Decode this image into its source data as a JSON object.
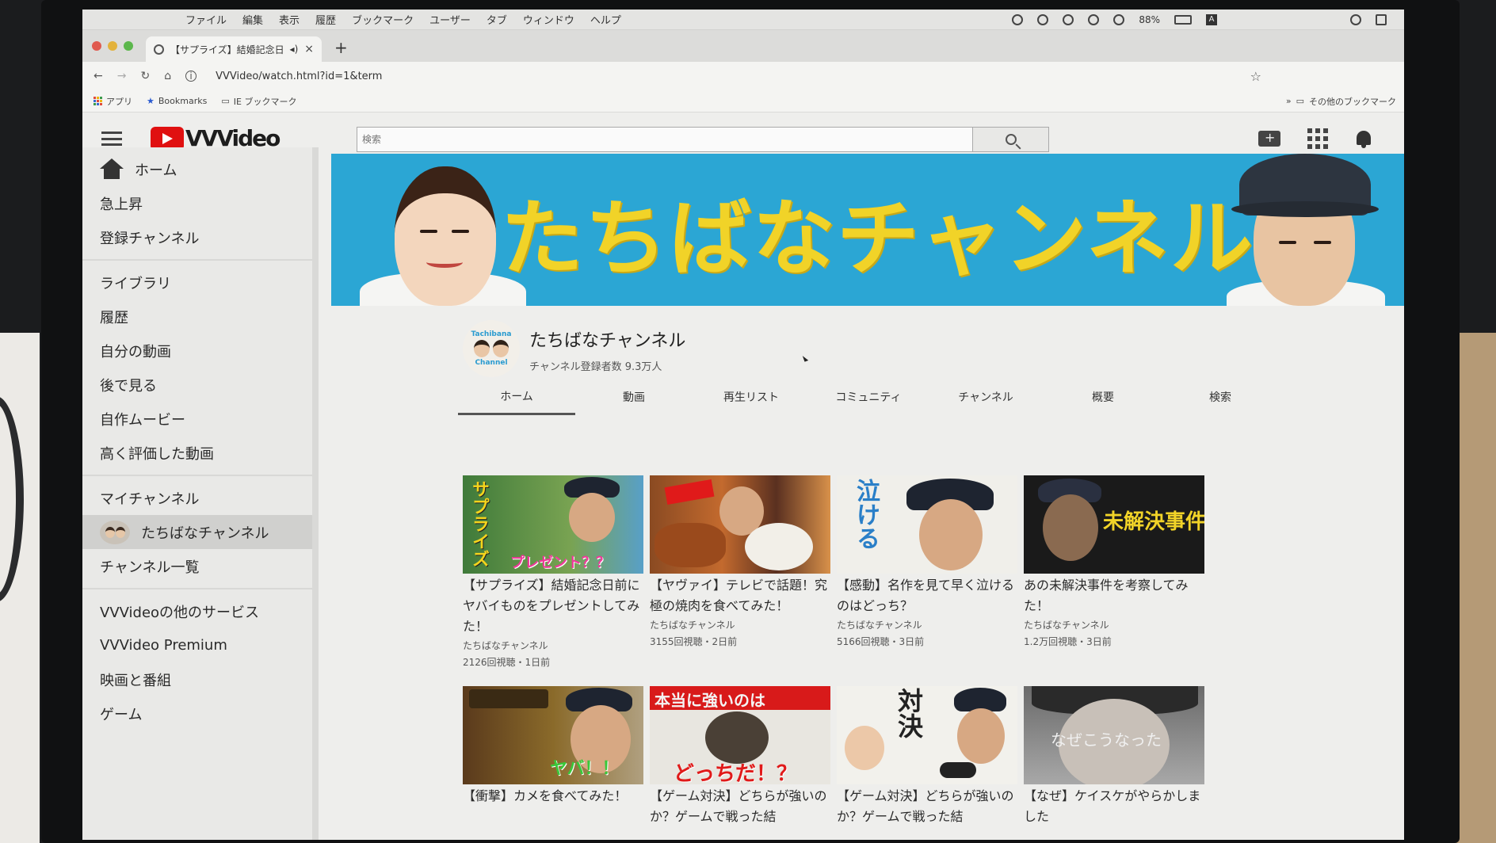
{
  "menubar": {
    "items": [
      "ファイル",
      "編集",
      "表示",
      "履歴",
      "ブックマーク",
      "ユーザー",
      "タブ",
      "ウィンドウ",
      "ヘルプ"
    ],
    "battery": "88%",
    "input_mode": "A"
  },
  "browser": {
    "tab_title": "【サプライズ】結婚記念日",
    "url": "VVVideo/watch.html?id=1&term",
    "bookmarks": {
      "apps": "アプリ",
      "bookmarks": "Bookmarks",
      "ie": "IE ブックマーク",
      "other": "その他のブックマーク"
    }
  },
  "app": {
    "logo": "VVVideo",
    "search_placeholder": "検索"
  },
  "sidebar": {
    "section1": [
      "ホーム",
      "急上昇",
      "登録チャンネル"
    ],
    "section2": [
      "ライブラリ",
      "履歴",
      "自分の動画",
      "後で見る",
      "自作ムービー",
      "高く評価した動画"
    ],
    "section3_title": "マイチャンネル",
    "active_channel": "たちばなチャンネル",
    "channel_list": "チャンネル一覧",
    "section4": [
      "VVVideoの他のサービス",
      "VVVideo Premium",
      "映画と番組",
      "ゲーム"
    ]
  },
  "channel": {
    "banner_title": "たちばなチャンネル",
    "avatar_text_top": "Tachibana",
    "avatar_text_bottom": "Channel",
    "name": "たちばなチャンネル",
    "subscribers": "チャンネル登録者数 9.3万人",
    "tabs": [
      "ホーム",
      "動画",
      "再生リスト",
      "コミュニティ",
      "チャンネル",
      "概要",
      "検索"
    ]
  },
  "videos": [
    {
      "title": "【サプライズ】結婚記念日前にヤバイものをプレゼントしてみた！",
      "channel": "たちばなチャンネル",
      "meta": "2126回視聴・1日前",
      "thumb_text": "サプライズ",
      "thumb_text2": "プレゼント？？"
    },
    {
      "title": "【ヤヴァイ】テレビで話題！究極の焼肉を食べてみた！",
      "channel": "たちばなチャンネル",
      "meta": "3155回視聴・2日前",
      "thumb_text": "",
      "thumb_text2": ""
    },
    {
      "title": "【感動】名作を見て早く泣けるのはどっち？",
      "channel": "たちばなチャンネル",
      "meta": "5166回視聴・3日前",
      "thumb_text": "泣ける",
      "thumb_text2": ""
    },
    {
      "title": "あの未解決事件を考察してみた！",
      "channel": "たちばなチャンネル",
      "meta": "1.2万回視聴・3日前",
      "thumb_text": "未解決事件",
      "thumb_text2": ""
    },
    {
      "title": "【衝撃】カメを食べてみた！",
      "channel": "",
      "meta": "",
      "thumb_text": "",
      "thumb_text2": "ヤバ！！"
    },
    {
      "title": "【ゲーム対決】どちらが強いのか？ゲームで戦った結",
      "channel": "",
      "meta": "",
      "thumb_text": "本当に強いのは",
      "thumb_text2": "どっちだ！？"
    },
    {
      "title": "【ゲーム対決】どちらが強いのか？ゲームで戦った結",
      "channel": "",
      "meta": "",
      "thumb_text": "対決",
      "thumb_text2": ""
    },
    {
      "title": "【なぜ】ケイスケがやらかしました",
      "channel": "",
      "meta": "",
      "thumb_text": "なぜこうなった",
      "thumb_text2": ""
    }
  ]
}
